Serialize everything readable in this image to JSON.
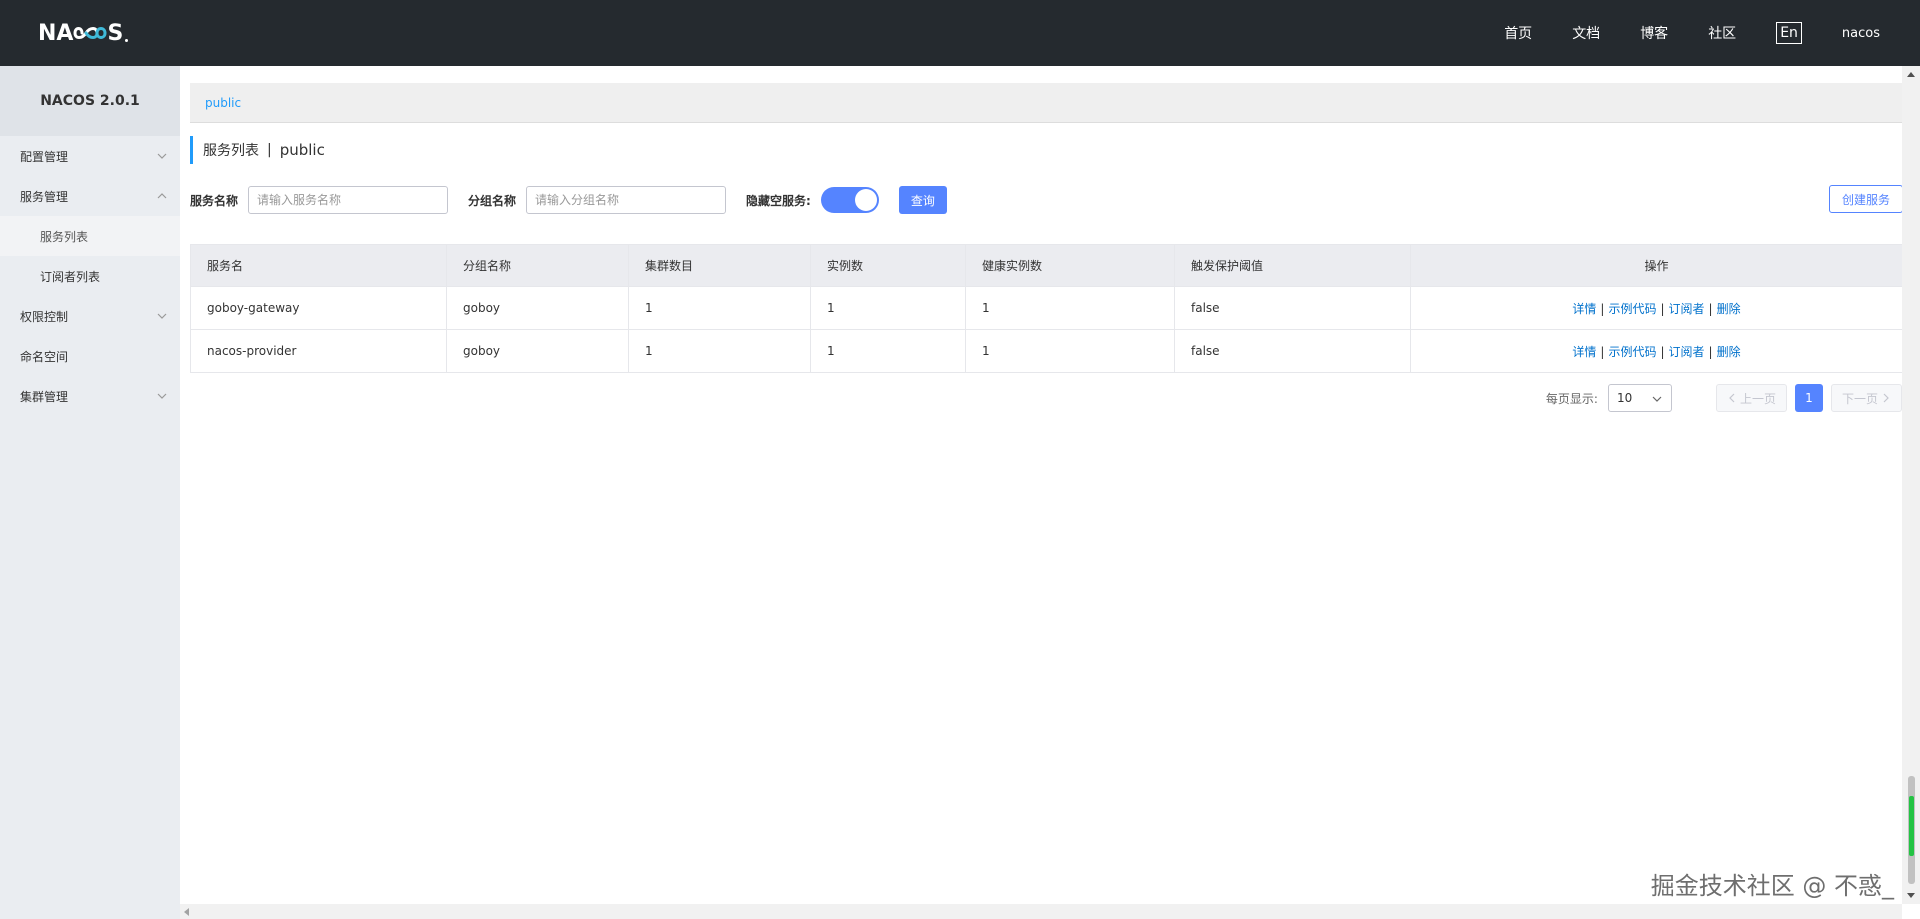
{
  "app": {
    "logo_text": "NACOS"
  },
  "topnav": {
    "links": [
      "首页",
      "文档",
      "博客",
      "社区"
    ],
    "lang": "En",
    "user": "nacos"
  },
  "sidebar": {
    "version": "NACOS 2.0.1",
    "items": [
      {
        "label": "配置管理"
      },
      {
        "label": "服务管理"
      },
      {
        "label": "服务列表"
      },
      {
        "label": "订阅者列表"
      },
      {
        "label": "权限控制"
      },
      {
        "label": "命名空间"
      },
      {
        "label": "集群管理"
      }
    ]
  },
  "namespace": {
    "items": [
      "public"
    ]
  },
  "page": {
    "title": "服务列表",
    "separator": "|",
    "namespace": "public"
  },
  "filters": {
    "service_label": "服务名称",
    "service_placeholder": "请输入服务名称",
    "group_label": "分组名称",
    "group_placeholder": "请输入分组名称",
    "hide_empty_label": "隐藏空服务:",
    "hide_empty_on": true,
    "query_label": "查询",
    "create_label": "创建服务"
  },
  "table": {
    "columns": [
      "服务名",
      "分组名称",
      "集群数目",
      "实例数",
      "健康实例数",
      "触发保护阈值",
      "操作"
    ],
    "rows": [
      {
        "name": "goboy-gateway",
        "group": "goboy",
        "clusters": "1",
        "instances": "1",
        "healthy": "1",
        "threshold": "false"
      },
      {
        "name": "nacos-provider",
        "group": "goboy",
        "clusters": "1",
        "instances": "1",
        "healthy": "1",
        "threshold": "false"
      }
    ],
    "actions": {
      "detail": "详情",
      "sample": "示例代码",
      "subscriber": "订阅者",
      "delete": "删除",
      "sep": "|"
    }
  },
  "pagination": {
    "page_size_label": "每页显示:",
    "page_size": "10",
    "prev": "上一页",
    "next": "下一页",
    "current": "1"
  },
  "watermark": "掘金技术社区 @ 不惑_",
  "colors": {
    "topnav_bg": "#252a2f",
    "primary": "#5584ff",
    "link": "#0071cc",
    "namespace_link": "#209bfa"
  }
}
